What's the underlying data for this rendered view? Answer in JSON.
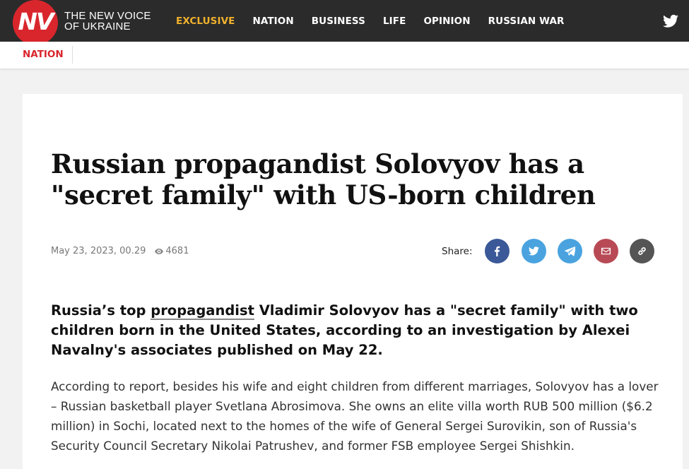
{
  "header": {
    "logo_text": "NV",
    "brand_line1": "THE NEW VOICE",
    "brand_line2": "OF UKRAINE",
    "nav": [
      {
        "label": "EXCLUSIVE"
      },
      {
        "label": "NATION"
      },
      {
        "label": "BUSINESS"
      },
      {
        "label": "LIFE"
      },
      {
        "label": "OPINION"
      },
      {
        "label": "RUSSIAN WAR"
      }
    ],
    "social_icon": "twitter-icon"
  },
  "subbar": {
    "section": "NATION"
  },
  "article": {
    "title": "Russian propagandist Solovyov has a \"secret family\" with US-born children",
    "date": "May 23, 2023, 00.29",
    "views": "4681",
    "share_label": "Share:",
    "share_buttons": [
      {
        "icon": "facebook-icon",
        "color": "#3b5998"
      },
      {
        "icon": "twitter-icon",
        "color": "#4aa3df"
      },
      {
        "icon": "telegram-icon",
        "color": "#4aa3df"
      },
      {
        "icon": "email-icon",
        "color": "#b84a55"
      },
      {
        "icon": "link-icon",
        "color": "#555555"
      }
    ],
    "lead_before": "Russia’s top ",
    "lead_link": "propagandist",
    "lead_after": " Vladimir Solovyov has a \"secret family\" with two children born in the United States, according to an investigation by Alexei Navalny's associates published on May 22.",
    "paragraph": "According to report, besides his wife and eight children from different marriages, Solovyov has a lover – Russian basketball player Svetlana Abrosimova. She owns an elite villa worth RUB 500 million ($6.2 million) in Sochi, located next to the homes of the wife of General Sergei Surovikin, son of Russia's Security Council Secretary Nikolai Patrushev, and former FSB employee Sergei Shishkin."
  },
  "colors": {
    "brand_red": "#d8262c",
    "exclusive_gold": "#f0b12d",
    "topbar_bg": "#2b2b2b"
  }
}
